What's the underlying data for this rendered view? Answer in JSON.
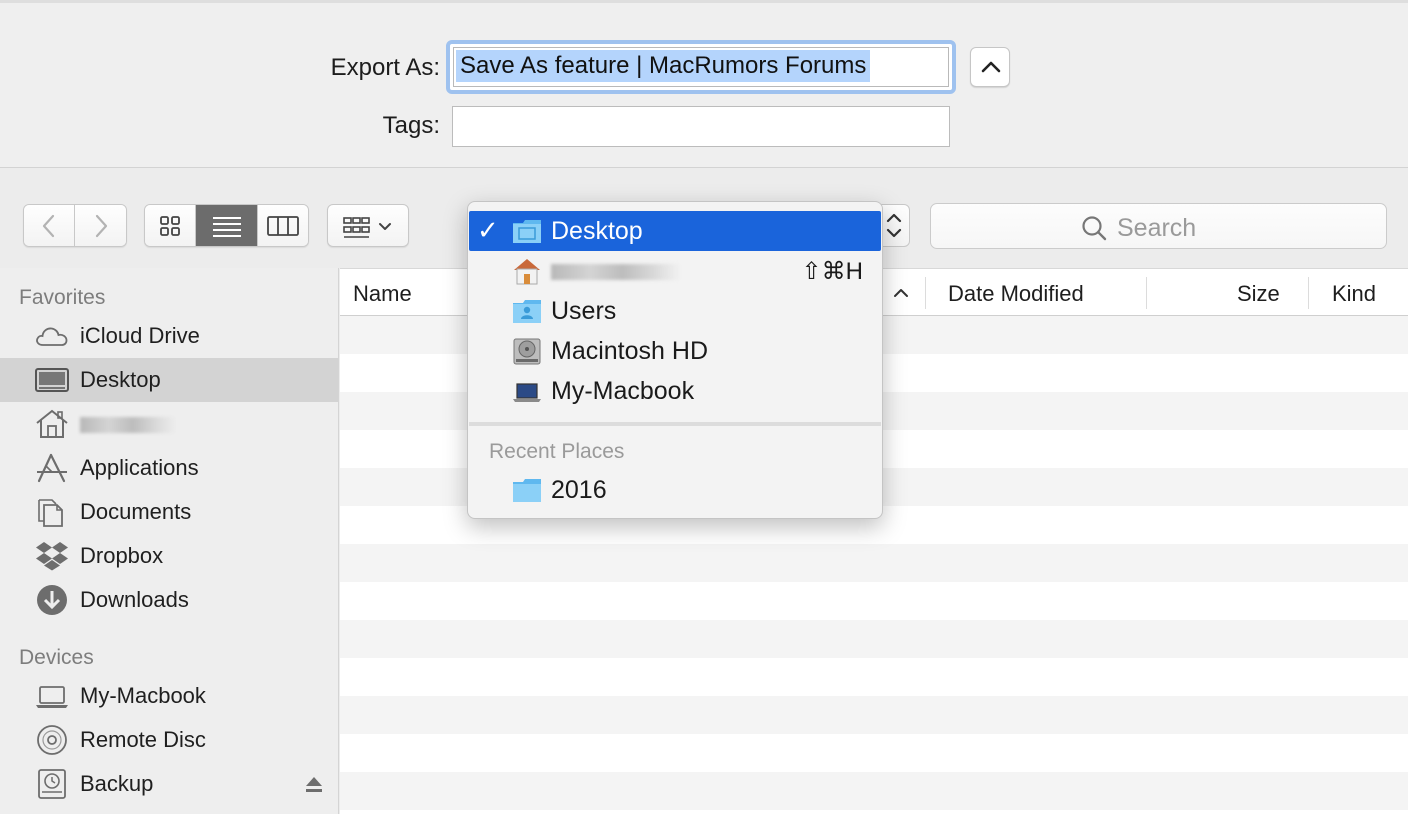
{
  "export": {
    "label": "Export As:",
    "filename": "Save As feature | MacRumors Forums"
  },
  "tags": {
    "label": "Tags:",
    "value": ""
  },
  "toolbar": {
    "search_placeholder": "Search"
  },
  "sidebar": {
    "favorites_header": "Favorites",
    "favorites": [
      {
        "label": "iCloud Drive",
        "icon": "cloud-icon"
      },
      {
        "label": "Desktop",
        "icon": "desktop-icon",
        "selected": true
      },
      {
        "label": "",
        "icon": "home-icon",
        "redacted": true
      },
      {
        "label": "Applications",
        "icon": "applications-icon"
      },
      {
        "label": "Documents",
        "icon": "document-icon"
      },
      {
        "label": "Dropbox",
        "icon": "dropbox-icon"
      },
      {
        "label": "Downloads",
        "icon": "download-icon"
      }
    ],
    "devices_header": "Devices",
    "devices": [
      {
        "label": "My-Macbook",
        "icon": "laptop-icon"
      },
      {
        "label": "Remote Disc",
        "icon": "disc-icon"
      },
      {
        "label": "Backup",
        "icon": "backup-drive-icon",
        "eject": true
      }
    ]
  },
  "columns": {
    "name": "Name",
    "date_modified": "Date Modified",
    "size": "Size",
    "kind": "Kind"
  },
  "location_menu": {
    "items": [
      {
        "label": "Desktop",
        "icon": "desktop-folder-icon",
        "checked": true
      },
      {
        "label": "",
        "icon": "home-icon",
        "redacted": true,
        "shortcut": "⇧⌘H"
      },
      {
        "label": "Users",
        "icon": "users-folder-icon"
      },
      {
        "label": "Macintosh HD",
        "icon": "hard-drive-icon"
      },
      {
        "label": "My-Macbook",
        "icon": "laptop-icon"
      }
    ],
    "recent_header": "Recent Places",
    "recent": [
      {
        "label": "2016",
        "icon": "folder-icon"
      }
    ]
  },
  "colors": {
    "accent": "#1a64db",
    "selection_text": "#b4d4fc",
    "focus_ring": "#9fc2ef"
  }
}
